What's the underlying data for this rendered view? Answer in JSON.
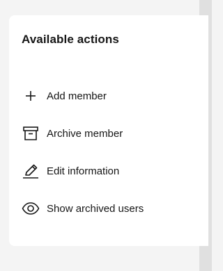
{
  "panel": {
    "title": "Available actions",
    "actions": [
      {
        "label": "Add member",
        "icon": "plus-icon"
      },
      {
        "label": "Archive member",
        "icon": "archive-box-icon"
      },
      {
        "label": "Edit information",
        "icon": "pencil-icon"
      },
      {
        "label": "Show archived users",
        "icon": "eye-icon"
      }
    ]
  }
}
